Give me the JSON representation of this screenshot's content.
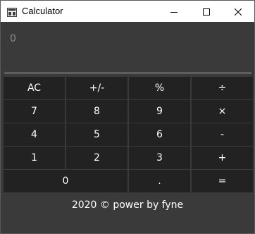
{
  "window": {
    "title": "Calculator"
  },
  "display": {
    "value": "0"
  },
  "keys": {
    "ac": "AC",
    "negate": "+/-",
    "percent": "%",
    "divide": "÷",
    "seven": "7",
    "eight": "8",
    "nine": "9",
    "multiply": "×",
    "four": "4",
    "five": "5",
    "six": "6",
    "subtract": "-",
    "one": "1",
    "two": "2",
    "three": "3",
    "add": "+",
    "zero": "0",
    "decimal": ".",
    "equals": "="
  },
  "footer": {
    "text": "2020 © power by fyne"
  },
  "icons": {
    "app": "calculator-app-icon",
    "minimize": "minimize-icon",
    "maximize": "maximize-icon",
    "close": "close-icon"
  },
  "colors": {
    "background": "#3a3a3a",
    "key_background": "#222222",
    "display_text": "#8c8c8c",
    "text": "#ffffff"
  }
}
